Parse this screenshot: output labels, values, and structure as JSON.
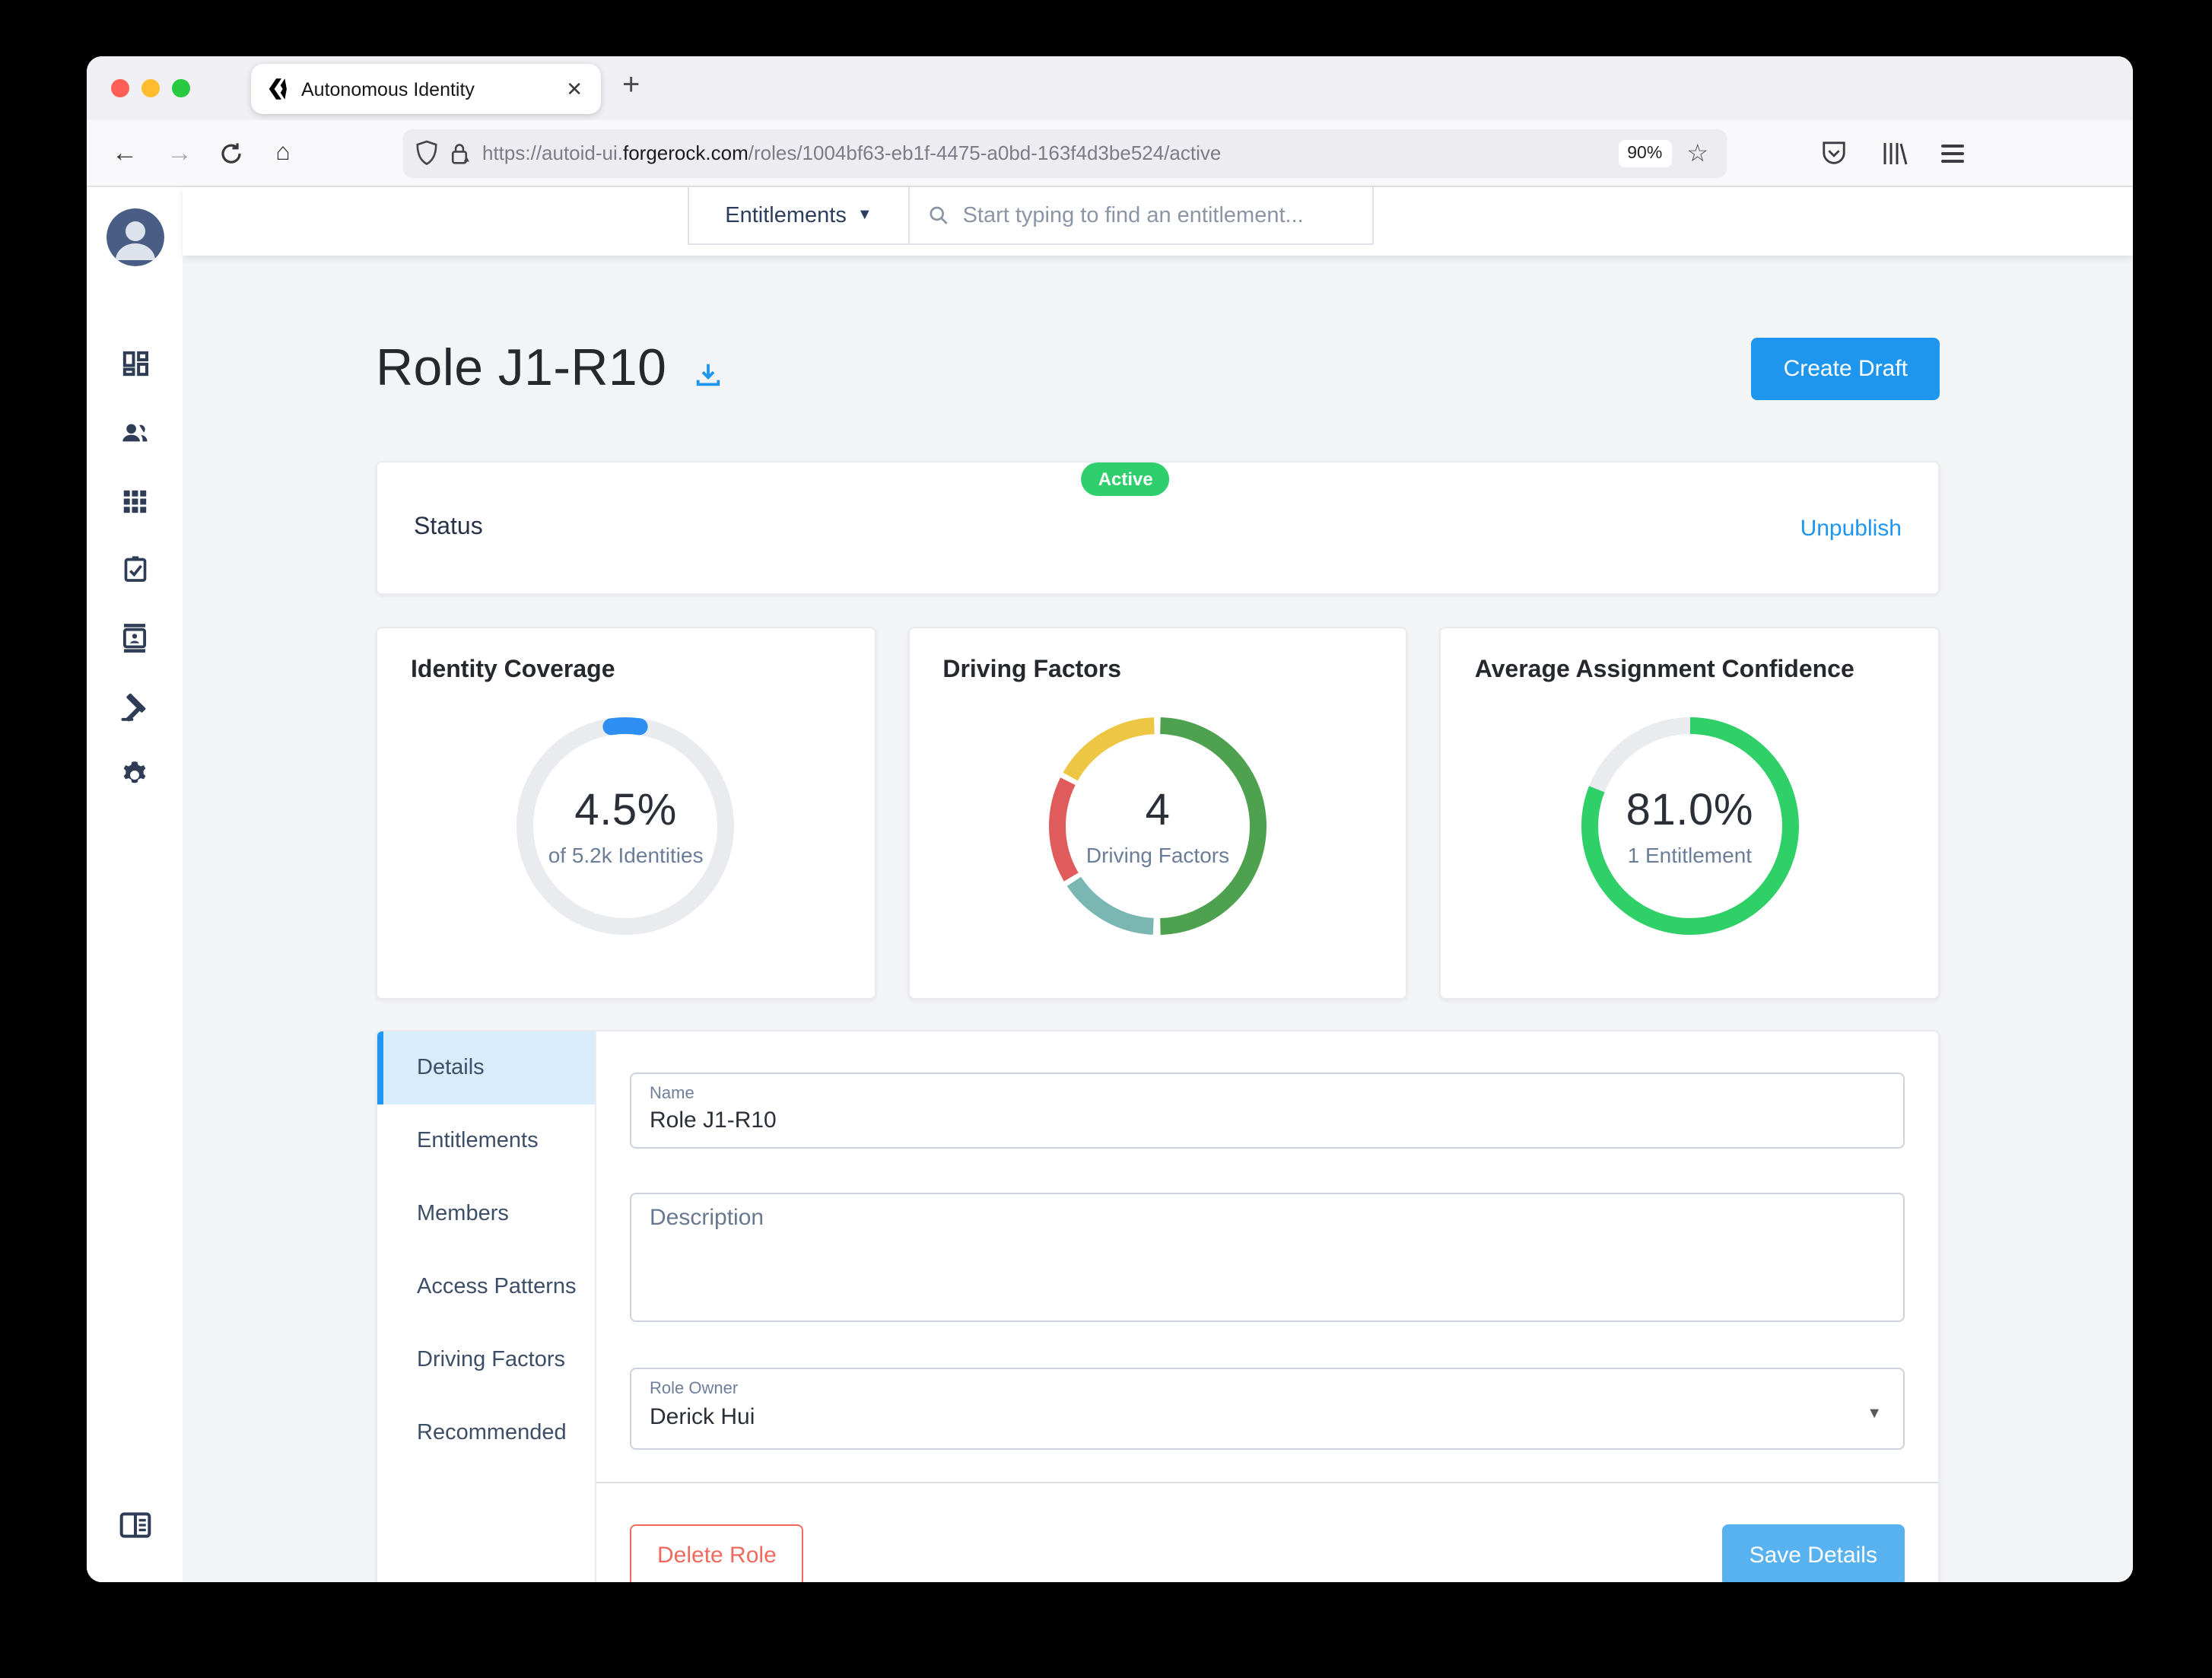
{
  "browser": {
    "tab_title": "Autonomous Identity",
    "close_tab": "✕",
    "new_tab": "+",
    "back": "←",
    "forward": "→",
    "home": "⌂",
    "url_scheme_sub": "https://autoid-ui.",
    "url_domain": "forgerock.com",
    "url_path": "/roles/1004bf63-eb1f-4475-a0bd-163f4d3be524/active",
    "zoom_level": "90%",
    "star": "☆"
  },
  "topbar": {
    "scope_label": "Entitlements",
    "scope_caret": "▼",
    "search_placeholder": "Start typing to find an entitlement..."
  },
  "page": {
    "title": "Role J1-R10",
    "create_draft_label": "Create Draft",
    "status_label": "Status",
    "status_value": "Active",
    "unpublish_label": "Unpublish"
  },
  "chart_data": [
    {
      "type": "donut",
      "title": "Identity Coverage",
      "value": "4.5%",
      "subtitle": "of 5.2k Identities",
      "percent": 4.5,
      "track": "#e9ebee",
      "arcs": [
        {
          "start": -8.1,
          "end": 8.1,
          "color": "#2e8ff2",
          "cap": "round"
        }
      ]
    },
    {
      "type": "donut",
      "title": "Driving Factors",
      "value": "4",
      "subtitle": "Driving Factors",
      "segments_percent": [
        49,
        15,
        16,
        17
      ],
      "arcs": [
        {
          "start": 1.5,
          "end": 178.5,
          "color": "#4ea24f"
        },
        {
          "start": 182.5,
          "end": 236.5,
          "color": "#7ab7b3"
        },
        {
          "start": 239.5,
          "end": 296.5,
          "color": "#e05c5c"
        },
        {
          "start": 299.5,
          "end": 358.0,
          "color": "#edc644"
        }
      ]
    },
    {
      "type": "donut",
      "title": "Average Assignment Confidence",
      "value": "81.0%",
      "subtitle": "1 Entitlement",
      "percent": 81.0,
      "track": "#e9ebee",
      "arcs": [
        {
          "start": 0,
          "end": 291.6,
          "color": "#2fd068"
        }
      ]
    }
  ],
  "tabs": {
    "details": "Details",
    "entitlements": "Entitlements",
    "members": "Members",
    "access_patterns": "Access Patterns",
    "driving_factors": "Driving Factors",
    "recommended": "Recommended"
  },
  "form": {
    "name_label": "Name",
    "name_value": "Role J1-R10",
    "description_placeholder": "Description",
    "owner_label": "Role Owner",
    "owner_value": "Derick Hui",
    "delete_label": "Delete Role",
    "save_label": "Save Details"
  },
  "colors": {
    "accent_blue": "#1e96ee",
    "save_blue": "#58b2ef",
    "active_green": "#2fcf6d",
    "danger_red": "#ef6a5e"
  }
}
